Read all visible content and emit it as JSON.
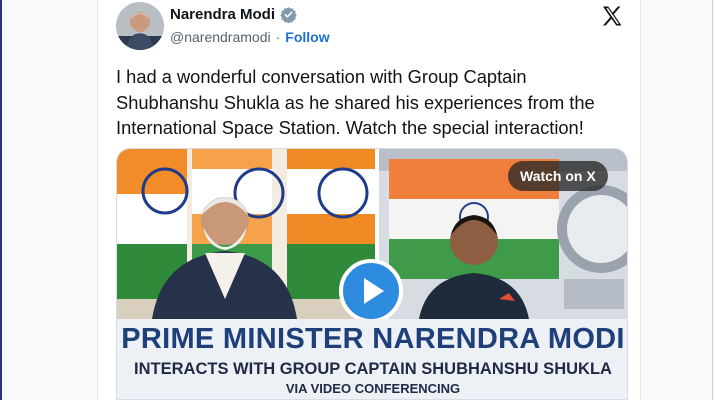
{
  "author": {
    "name": "Narendra Modi",
    "handle": "@narendramodi",
    "separator": "·",
    "follow_label": "Follow",
    "verified_icon": "verified-badge-icon",
    "accent_color": "#1d6fd6"
  },
  "tweet": {
    "text": "I had a wonderful conversation with Group Captain Shubhanshu Shukla as he shared his experiences from the International Space Station. Watch the special interaction!"
  },
  "media": {
    "watch_label": "Watch on X",
    "play_icon": "play-icon",
    "caption_line1": "PRIME MINISTER NARENDRA MODI",
    "caption_line2": "INTERACTS WITH GROUP CAPTAIN SHUBHANSHU SHUKLA",
    "caption_line3": "VIA VIDEO CONFERENCING"
  },
  "platform_icon": "x-logo-icon"
}
